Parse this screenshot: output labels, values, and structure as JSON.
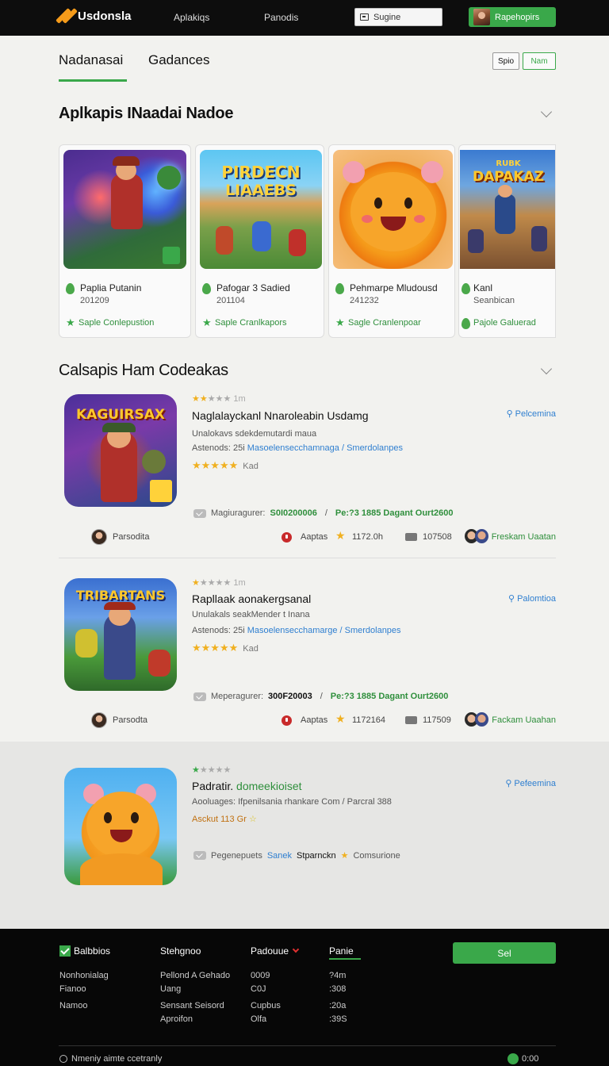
{
  "topbar": {
    "brand": "Usdonsla",
    "nav": [
      "Aplakiqs",
      "Panodis"
    ],
    "search_label": "Sugine",
    "user_label": "Rapehopirs"
  },
  "tabs": [
    "Nadanasai",
    "Gadances"
  ],
  "tab_buttons": [
    "Spio",
    "Nam"
  ],
  "sections": {
    "carousel_title": "Aplkapis INaadai Nadoe",
    "list_title": "Calsapis Ham Codeakas"
  },
  "carousel": [
    {
      "art": "hero",
      "title": "Paplia Putanin",
      "sub": "201209",
      "link": "Saple Conlepustion"
    },
    {
      "art": "pirate",
      "art_text": [
        "PIRDECN",
        "LIAAEBS"
      ],
      "title": "Pafogar 3 Sadied",
      "sub": "201104",
      "link": "Saple Cranlkapors"
    },
    {
      "art": "pet",
      "title": "Pehmarpe Mludousd",
      "sub": "241232",
      "link": "Sagle Cranlenpoar"
    },
    {
      "art": "war",
      "art_text": [
        "RUBK",
        "DAPAKAZ"
      ],
      "title": "Kanl",
      "sub": "Seanbican",
      "link": "Pajole Galuerad"
    }
  ],
  "list": [
    {
      "art": "list1",
      "art_text": "KAGUIRSAX",
      "small_rating": "1m",
      "title": "Naglalayckanl Nnaroleabin Usdamg",
      "line1": "Unalokavs sdekdemutardi maua",
      "line2_prefix": "Astenods: 25i",
      "line2_link": "Masoelensecchamnaga / Smerdolanpes",
      "rating_text": "Kad",
      "pay": "Pelcemina",
      "meta_label": "Magiuragurer:",
      "meta_value": "S0I0200006",
      "meta_sep": "/",
      "meta_right": "Pe:?3 1885 Dagant Ourt2600",
      "author": "Parsodita",
      "loc": "Aaptas",
      "count1": "1172.0h",
      "count2": "107508",
      "friend": "Freskam Uaatan"
    },
    {
      "art": "list2",
      "art_text": "TRIBARTANS",
      "small_rating": "1m",
      "title": "Rapllaak aonakergsanal",
      "line1": "Unulakals seakMender t Inana",
      "line2_prefix": "Astenods: 25i",
      "line2_link": "Masoelensecchamarge / Smerdolanpes",
      "rating_text": "Kad",
      "pay": "Palomtioa",
      "meta_label": "Meperagurer:",
      "meta_value": "300F20003",
      "meta_sep": "/",
      "meta_right": "Pe:?3 1885 Dagant Ourt2600",
      "author": "Parsodta",
      "loc": "Aaptas",
      "count1": "1172164",
      "count2": "117509",
      "friend": "Fackam Uaahan"
    },
    {
      "art": "list3",
      "small_rating": "",
      "title_main": "Padratir.",
      "title_green": "domeekioiset",
      "line1": "Aooluages: Ifpenilsania rhankare Com / Parcral 388",
      "line2": "Asckut 113 Gr",
      "pay": "Pefeemina",
      "meta_label": "Pegenepuets",
      "meta_blue": "Sanek",
      "meta_black": "Stparnckn",
      "meta_end": "Comsurione"
    }
  ],
  "footer": {
    "cols": [
      {
        "head": "Balbbios",
        "items": [
          "Nonhonialag",
          "Fianoo",
          "Namoo"
        ]
      },
      {
        "head": "Stehgnoo",
        "items": [
          "Pellond A Gehado",
          "Uang",
          "Sensant Seisord",
          "Aproifon"
        ]
      },
      {
        "head": "Padouue",
        "items": [
          "0009",
          "C0J",
          "Cupbus",
          "Olfa"
        ]
      },
      {
        "head": "Panie",
        "items": [
          "?4m",
          ":308",
          ":20a",
          ":39S"
        ]
      }
    ],
    "button": "Sel",
    "bottom_left": "Nmeniy aimte ccetranly",
    "bottom_right": "0:00"
  },
  "colors": {
    "accent": "#3aa84a",
    "topbar": "#0d0d0d",
    "link": "#2f7fd0",
    "star": "#f0b020"
  }
}
